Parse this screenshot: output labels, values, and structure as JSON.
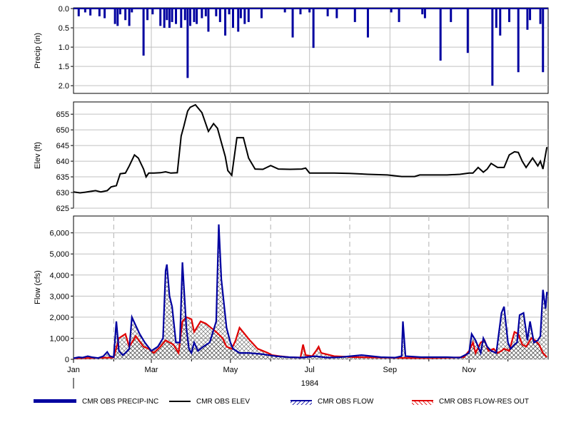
{
  "chart_data": [
    {
      "type": "bar",
      "ylabel": "Precip (in)",
      "ylim": [
        0,
        2.2
      ],
      "y_inverted": true,
      "yticks": [
        0.0,
        0.5,
        1.0,
        1.5,
        2.0
      ],
      "ytick_labels": [
        "0.0",
        "0.5",
        "1.0",
        "1.5",
        "2.0"
      ],
      "series_color": "#0000a0",
      "series": [
        {
          "name": "CMR OBS PRECIP-INC",
          "x": [
            "1984-01-05",
            "1984-01-10",
            "1984-01-14",
            "1984-01-21",
            "1984-01-25",
            "1984-02-02",
            "1984-02-04",
            "1984-02-06",
            "1984-02-10",
            "1984-02-13",
            "1984-02-15",
            "1984-02-24",
            "1984-02-27",
            "1984-03-02",
            "1984-03-08",
            "1984-03-11",
            "1984-03-13",
            "1984-03-15",
            "1984-03-17",
            "1984-03-20",
            "1984-03-24",
            "1984-03-27",
            "1984-03-29",
            "1984-03-31",
            "1984-04-03",
            "1984-04-05",
            "1984-04-09",
            "1984-04-12",
            "1984-04-14",
            "1984-04-20",
            "1984-04-23",
            "1984-04-27",
            "1984-04-30",
            "1984-05-03",
            "1984-05-07",
            "1984-05-09",
            "1984-05-12",
            "1984-05-15",
            "1984-05-25",
            "1984-06-12",
            "1984-06-18",
            "1984-06-24",
            "1984-07-01",
            "1984-07-04",
            "1984-07-15",
            "1984-07-22",
            "1984-08-05",
            "1984-08-15",
            "1984-09-02",
            "1984-09-08",
            "1984-09-26",
            "1984-09-28",
            "1984-10-10",
            "1984-10-18",
            "1984-10-31",
            "1984-11-19",
            "1984-11-22",
            "1984-11-25",
            "1984-12-02",
            "1984-12-09",
            "1984-12-16",
            "1984-12-18",
            "1984-12-26",
            "1984-12-28"
          ],
          "values": [
            0.2,
            0.1,
            0.18,
            0.2,
            0.25,
            0.4,
            0.45,
            0.15,
            0.3,
            0.45,
            0.1,
            1.22,
            0.3,
            0.15,
            0.45,
            0.5,
            0.3,
            0.5,
            0.35,
            0.4,
            0.5,
            0.3,
            1.8,
            0.45,
            0.35,
            0.4,
            0.25,
            0.2,
            0.6,
            0.2,
            0.35,
            0.7,
            0.15,
            0.5,
            0.6,
            0.25,
            0.4,
            0.35,
            0.25,
            0.1,
            0.75,
            0.15,
            0.1,
            1.02,
            0.2,
            0.25,
            0.35,
            0.75,
            0.1,
            0.35,
            0.15,
            0.25,
            1.35,
            0.35,
            1.15,
            2.0,
            0.5,
            0.7,
            0.35,
            1.65,
            0.55,
            0.3,
            0.4,
            1.65
          ]
        }
      ]
    },
    {
      "type": "line",
      "ylabel": "Elev (ft)",
      "ylim": [
        625,
        658
      ],
      "yticks": [
        625,
        630,
        635,
        640,
        645,
        650,
        655
      ],
      "ytick_labels": [
        "625",
        "630",
        "635",
        "640",
        "645",
        "650",
        "655"
      ],
      "series_color": "#000000",
      "series": [
        {
          "name": "CMR OBS ELEV",
          "x": [
            "1984-01-01",
            "1984-01-06",
            "1984-01-10",
            "1984-01-18",
            "1984-01-22",
            "1984-01-27",
            "1984-01-30",
            "1984-02-03",
            "1984-02-06",
            "1984-02-10",
            "1984-02-13",
            "1984-02-17",
            "1984-02-20",
            "1984-02-24",
            "1984-02-26",
            "1984-02-28",
            "1984-03-03",
            "1984-03-08",
            "1984-03-12",
            "1984-03-16",
            "1984-03-21",
            "1984-03-24",
            "1984-03-26",
            "1984-03-29",
            "1984-03-31",
            "1984-04-04",
            "1984-04-09",
            "1984-04-14",
            "1984-04-18",
            "1984-04-21",
            "1984-04-24",
            "1984-04-27",
            "1984-04-29",
            "1984-05-02",
            "1984-05-06",
            "1984-05-11",
            "1984-05-15",
            "1984-05-20",
            "1984-05-26",
            "1984-06-01",
            "1984-06-07",
            "1984-06-16",
            "1984-06-25",
            "1984-06-28",
            "1984-07-01",
            "1984-07-10",
            "1984-07-20",
            "1984-08-01",
            "1984-08-15",
            "1984-08-30",
            "1984-09-10",
            "1984-09-20",
            "1984-09-24",
            "1984-10-01",
            "1984-10-15",
            "1984-10-25",
            "1984-11-01",
            "1984-11-04",
            "1984-11-08",
            "1984-11-12",
            "1984-11-15",
            "1984-11-18",
            "1984-11-23",
            "1984-11-28",
            "1984-12-02",
            "1984-12-06",
            "1984-12-09",
            "1984-12-12",
            "1984-12-15",
            "1984-12-20",
            "1984-12-24",
            "1984-12-26",
            "1984-12-28",
            "1984-12-31"
          ],
          "values": [
            630.2,
            629.9,
            630.1,
            630.6,
            630.2,
            630.6,
            631.8,
            632.2,
            636.0,
            636.2,
            638.5,
            642.0,
            641.0,
            637.5,
            635.0,
            636.2,
            636.2,
            636.3,
            636.6,
            636.2,
            636.3,
            648.0,
            651.0,
            656.0,
            657.2,
            658.0,
            655.5,
            649.5,
            652.0,
            650.5,
            646.0,
            641.5,
            637.0,
            635.5,
            647.5,
            647.5,
            641.0,
            637.5,
            637.4,
            638.6,
            637.5,
            637.4,
            637.5,
            637.8,
            636.2,
            636.2,
            636.2,
            636.1,
            635.8,
            635.6,
            635.1,
            635.1,
            635.6,
            635.6,
            635.6,
            635.8,
            636.2,
            636.2,
            638.0,
            636.5,
            637.5,
            639.3,
            638.0,
            638.0,
            642.0,
            643.0,
            642.8,
            640.0,
            638.0,
            641.0,
            638.5,
            640.0,
            637.5,
            644.5
          ]
        }
      ]
    },
    {
      "type": "area",
      "xlabel": "1984",
      "ylabel": "Flow (cfs)",
      "ylim": [
        0,
        6800
      ],
      "yticks": [
        0,
        1000,
        2000,
        3000,
        4000,
        5000,
        6000
      ],
      "ytick_labels": [
        "0",
        "1,000",
        "2,000",
        "3,000",
        "4,000",
        "5,000",
        "6,000"
      ],
      "xlim": [
        "1984-01-01",
        "1985-01-01"
      ],
      "xticks": [
        "1984-01-01",
        "1984-03-01",
        "1984-05-01",
        "1984-07-01",
        "1984-09-01",
        "1984-11-01"
      ],
      "xtick_labels": [
        "Jan",
        "Mar",
        "May",
        "Jul",
        "Sep",
        "Nov"
      ],
      "minor_dashed": [
        "1984-02-01",
        "1984-04-01",
        "1984-06-01",
        "1984-08-01",
        "1984-10-01",
        "1984-12-01"
      ],
      "series": [
        {
          "name": "CMR OBS FLOW",
          "color": "#0000a0",
          "x": [
            "1984-01-01",
            "1984-01-05",
            "1984-01-08",
            "1984-01-12",
            "1984-01-15",
            "1984-01-20",
            "1984-01-24",
            "1984-01-27",
            "1984-01-29",
            "1984-02-01",
            "1984-02-03",
            "1984-02-05",
            "1984-02-08",
            "1984-02-10",
            "1984-02-13",
            "1984-02-15",
            "1984-02-18",
            "1984-02-21",
            "1984-02-25",
            "1984-03-01",
            "1984-03-06",
            "1984-03-10",
            "1984-03-12",
            "1984-03-13",
            "1984-03-15",
            "1984-03-17",
            "1984-03-20",
            "1984-03-23",
            "1984-03-25",
            "1984-03-28",
            "1984-03-30",
            "1984-04-01",
            "1984-04-03",
            "1984-04-06",
            "1984-04-10",
            "1984-04-15",
            "1984-04-20",
            "1984-04-22",
            "1984-04-24",
            "1984-04-28",
            "1984-05-01",
            "1984-05-03",
            "1984-05-08",
            "1984-05-15",
            "1984-05-25",
            "1984-06-05",
            "1984-06-15",
            "1984-06-25",
            "1984-07-05",
            "1984-07-15",
            "1984-07-25",
            "1984-08-10",
            "1984-08-25",
            "1984-09-05",
            "1984-09-10",
            "1984-09-11",
            "1984-09-13",
            "1984-09-25",
            "1984-10-05",
            "1984-10-15",
            "1984-10-25",
            "1984-11-01",
            "1984-11-03",
            "1984-11-06",
            "1984-11-10",
            "1984-11-12",
            "1984-11-15",
            "1984-11-18",
            "1984-11-22",
            "1984-11-26",
            "1984-11-28",
            "1984-12-01",
            "1984-12-03",
            "1984-12-06",
            "1984-12-08",
            "1984-12-10",
            "1984-12-13",
            "1984-12-16",
            "1984-12-18",
            "1984-12-21",
            "1984-12-24",
            "1984-12-26",
            "1984-12-28",
            "1984-12-30",
            "1984-12-31"
          ],
          "values": [
            50,
            100,
            80,
            150,
            100,
            60,
            150,
            350,
            150,
            100,
            1800,
            400,
            200,
            300,
            500,
            2000,
            1600,
            1200,
            800,
            400,
            600,
            1000,
            4200,
            4500,
            3000,
            2500,
            800,
            800,
            4600,
            1500,
            500,
            300,
            800,
            400,
            600,
            800,
            1800,
            6400,
            3800,
            1500,
            800,
            500,
            300,
            300,
            250,
            150,
            100,
            80,
            150,
            80,
            100,
            200,
            100,
            80,
            150,
            1800,
            150,
            100,
            100,
            100,
            80,
            300,
            1200,
            900,
            300,
            1000,
            600,
            400,
            300,
            2200,
            2500,
            800,
            500,
            700,
            800,
            2100,
            2200,
            900,
            1800,
            800,
            900,
            1100,
            3300,
            2400,
            3200
          ]
        },
        {
          "name": "CMR OBS FLOW-RES OUT",
          "color": "#e00000",
          "x": [
            "1984-01-01",
            "1984-01-15",
            "1984-02-01",
            "1984-02-05",
            "1984-02-10",
            "1984-02-13",
            "1984-02-18",
            "1984-02-24",
            "1984-02-28",
            "1984-03-03",
            "1984-03-08",
            "1984-03-12",
            "1984-03-18",
            "1984-03-22",
            "1984-03-25",
            "1984-03-28",
            "1984-04-01",
            "1984-04-03",
            "1984-04-08",
            "1984-04-12",
            "1984-04-16",
            "1984-04-20",
            "1984-04-25",
            "1984-04-28",
            "1984-05-02",
            "1984-05-05",
            "1984-05-08",
            "1984-05-12",
            "1984-05-16",
            "1984-05-19",
            "1984-05-22",
            "1984-05-26",
            "1984-05-30",
            "1984-06-02",
            "1984-06-08",
            "1984-06-15",
            "1984-06-24",
            "1984-06-26",
            "1984-06-28",
            "1984-07-03",
            "1984-07-06",
            "1984-07-08",
            "1984-07-10",
            "1984-07-20",
            "1984-08-05",
            "1984-08-25",
            "1984-09-15",
            "1984-10-05",
            "1984-10-20",
            "1984-10-28",
            "1984-11-01",
            "1984-11-04",
            "1984-11-06",
            "1984-11-10",
            "1984-11-13",
            "1984-11-16",
            "1984-11-20",
            "1984-11-23",
            "1984-11-26",
            "1984-11-28",
            "1984-12-02",
            "1984-12-06",
            "1984-12-09",
            "1984-12-12",
            "1984-12-15",
            "1984-12-19",
            "1984-12-22",
            "1984-12-25",
            "1984-12-28",
            "1984-12-31"
          ],
          "values": [
            50,
            60,
            80,
            1000,
            1200,
            600,
            1100,
            600,
            500,
            300,
            600,
            900,
            700,
            300,
            1800,
            2000,
            1900,
            1300,
            1800,
            1700,
            1500,
            1300,
            1000,
            600,
            500,
            900,
            1500,
            1200,
            900,
            700,
            500,
            400,
            300,
            200,
            150,
            100,
            80,
            700,
            200,
            150,
            400,
            600,
            300,
            150,
            100,
            80,
            60,
            60,
            80,
            100,
            400,
            800,
            300,
            800,
            900,
            400,
            500,
            300,
            400,
            500,
            400,
            1300,
            1200,
            700,
            600,
            1000,
            900,
            700,
            300,
            100
          ]
        }
      ]
    }
  ],
  "legend": {
    "items": [
      {
        "label": "CMR OBS PRECIP-INC",
        "color": "#0000a0"
      },
      {
        "label": "CMR OBS ELEV",
        "color": "#000000"
      },
      {
        "label": "CMR OBS FLOW",
        "color": "#0000a0"
      },
      {
        "label": "CMR OBS FLOW-RES OUT",
        "color": "#e00000"
      }
    ]
  }
}
